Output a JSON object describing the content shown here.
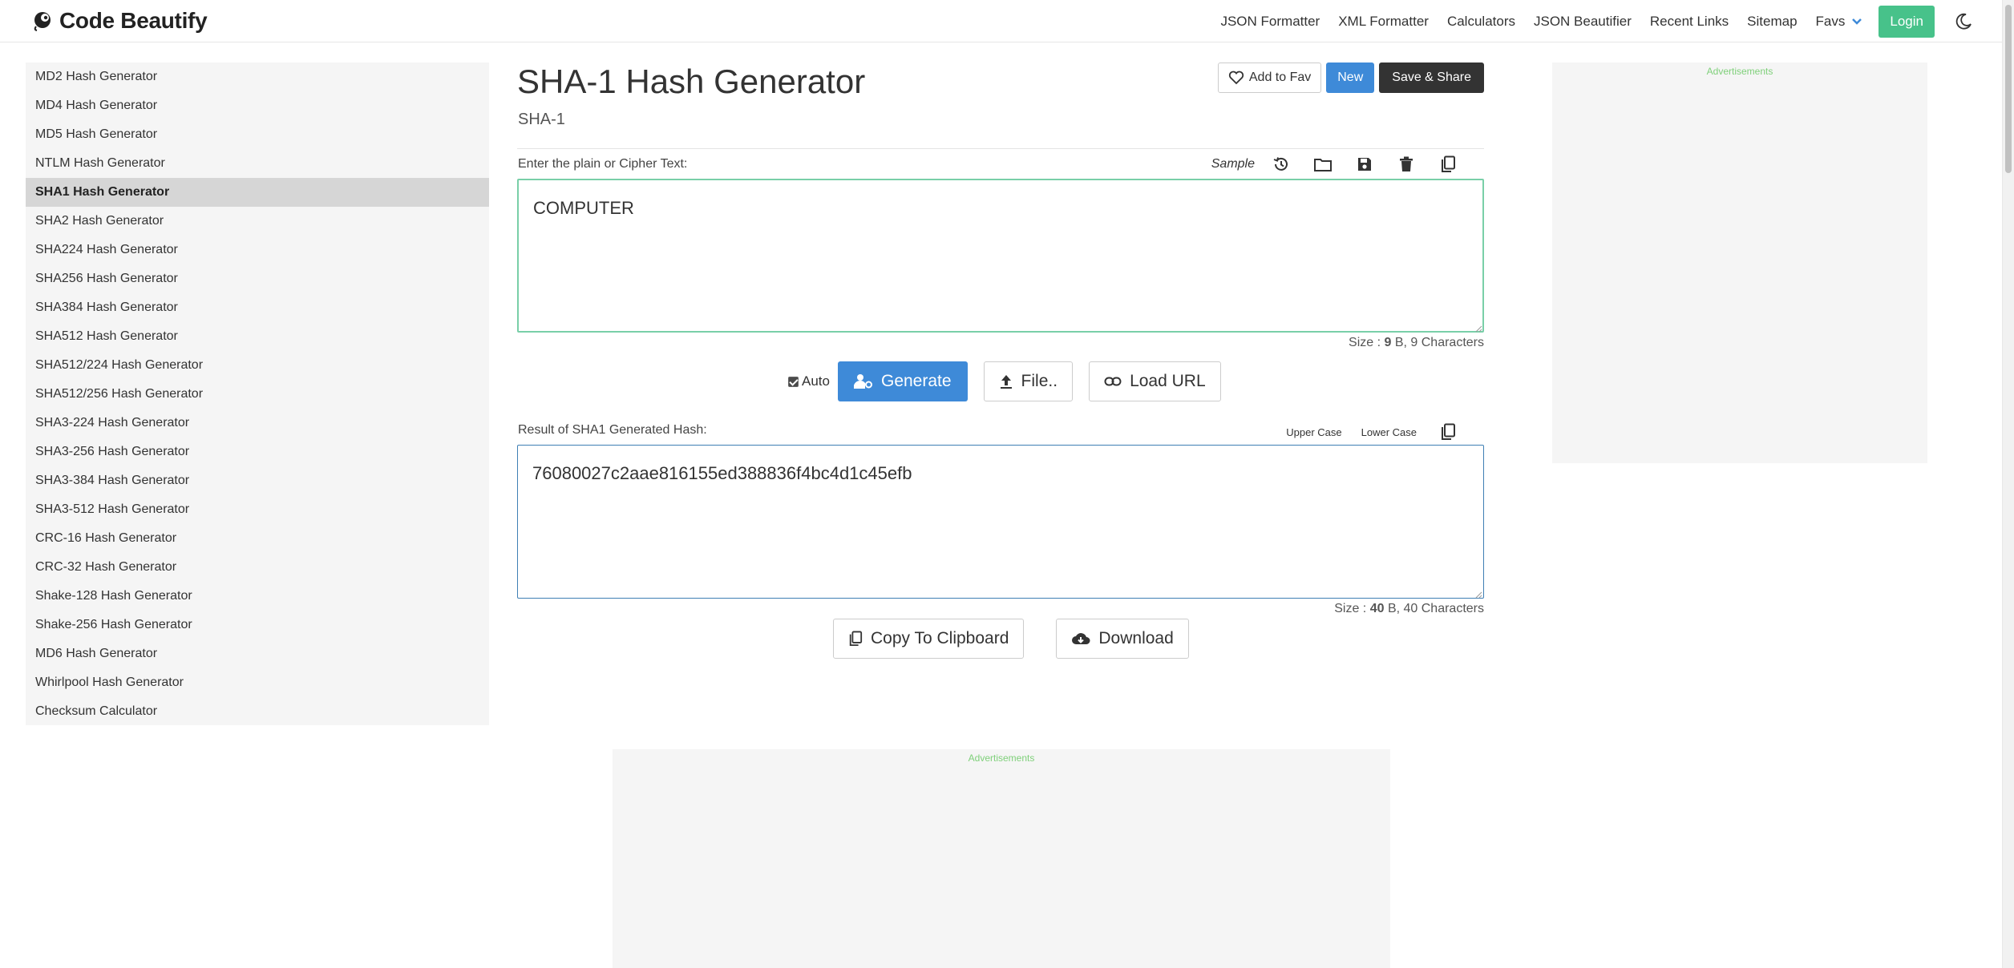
{
  "header": {
    "brand": "Code Beautify",
    "nav": [
      "JSON Formatter",
      "XML Formatter",
      "Calculators",
      "JSON Beautifier",
      "Recent Links",
      "Sitemap"
    ],
    "favs": "Favs",
    "login": "Login"
  },
  "sidebar": {
    "items": [
      "MD2 Hash Generator",
      "MD4 Hash Generator",
      "MD5 Hash Generator",
      "NTLM Hash Generator",
      "SHA1 Hash Generator",
      "SHA2 Hash Generator",
      "SHA224 Hash Generator",
      "SHA256 Hash Generator",
      "SHA384 Hash Generator",
      "SHA512 Hash Generator",
      "SHA512/224 Hash Generator",
      "SHA512/256 Hash Generator",
      "SHA3-224 Hash Generator",
      "SHA3-256 Hash Generator",
      "SHA3-384 Hash Generator",
      "SHA3-512 Hash Generator",
      "CRC-16 Hash Generator",
      "CRC-32 Hash Generator",
      "Shake-128 Hash Generator",
      "Shake-256 Hash Generator",
      "MD6 Hash Generator",
      "Whirlpool Hash Generator",
      "Checksum Calculator"
    ],
    "active_index": 4
  },
  "main": {
    "title": "SHA-1 Hash Generator",
    "subtitle": "SHA-1",
    "add_to_fav": "Add to Fav",
    "new": "New",
    "save_share": "Save & Share",
    "input_label": "Enter the plain or Cipher Text:",
    "sample": "Sample",
    "input_value": "COMPUTER",
    "input_size_prefix": "Size : ",
    "input_size_bytes": "9",
    "input_size_suffix": " B, 9 Characters",
    "auto_label": "Auto",
    "generate": "Generate",
    "file": "File..",
    "load_url": "Load URL",
    "output_label": "Result of SHA1 Generated Hash:",
    "upper_case": "Upper Case",
    "lower_case": "Lower Case",
    "output_value": "76080027c2aae816155ed388836f4bc4d1c45efb",
    "output_size_prefix": "Size : ",
    "output_size_bytes": "40",
    "output_size_suffix": " B, 40 Characters",
    "copy_clipboard": "Copy To Clipboard",
    "download": "Download"
  },
  "ads": {
    "label": "Advertisements"
  },
  "colors": {
    "accent_blue": "#3e8ad8",
    "login_green": "#47c28a",
    "input_border": "#79cfa8",
    "output_border": "#3f7fb4"
  }
}
